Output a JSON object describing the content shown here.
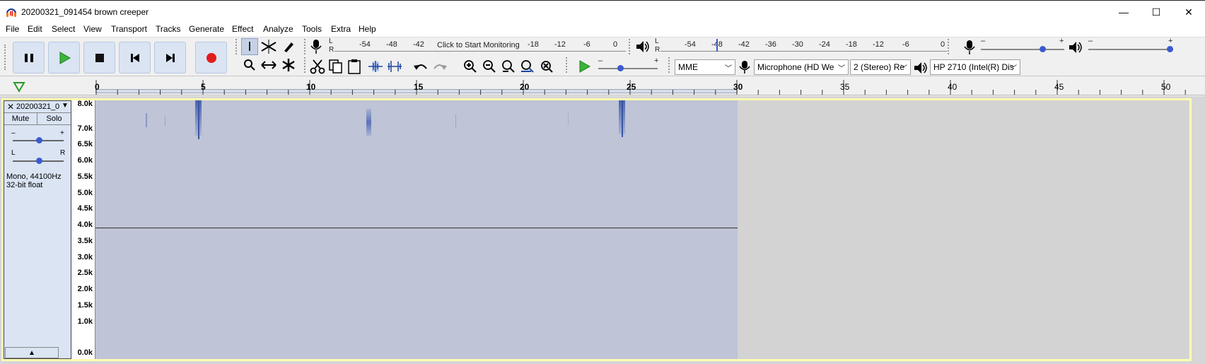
{
  "window": {
    "title": "20200321_091454 brown creeper",
    "minimize": "—",
    "maximize": "☐",
    "close": "✕"
  },
  "menu": [
    "File",
    "Edit",
    "Select",
    "View",
    "Transport",
    "Tracks",
    "Generate",
    "Effect",
    "Analyze",
    "Tools",
    "Extra",
    "Help"
  ],
  "transport": {
    "buttons": [
      "pause",
      "play",
      "stop",
      "skip-start",
      "skip-end",
      "record"
    ]
  },
  "recording_meter": {
    "ticks": [
      "-54",
      "-48",
      "-42",
      "-18",
      "-12",
      "-6",
      "0"
    ],
    "prompt": "Click to Start Monitoring",
    "L": "L",
    "R": "R"
  },
  "playback_meter": {
    "ticks": [
      "-54",
      "-48",
      "-42",
      "-36",
      "-30",
      "-24",
      "-18",
      "-12",
      "-6",
      "0"
    ],
    "L": "L",
    "R": "R"
  },
  "mixer": {
    "minus": "–",
    "plus": "+"
  },
  "devices": {
    "host": "MME",
    "input": "Microphone (HD We",
    "channels": "2 (Stereo) Re",
    "output": "HP 2710 (Intel(R) Dis"
  },
  "timeline": {
    "ticks": [
      "0",
      "5",
      "10",
      "15",
      "20",
      "25",
      "30",
      "35",
      "40",
      "45",
      "50"
    ]
  },
  "track": {
    "name": "20200321_0",
    "mute": "Mute",
    "solo": "Solo",
    "gain_minus": "–",
    "gain_plus": "+",
    "pan_left": "L",
    "pan_right": "R",
    "info_line1": "Mono, 44100Hz",
    "info_line2": "32-bit float",
    "freq_labels": [
      "8.0k",
      "7.0k",
      "6.5k",
      "6.0k",
      "5.5k",
      "5.0k",
      "4.5k",
      "4.0k",
      "3.5k",
      "3.0k",
      "2.5k",
      "2.0k",
      "1.5k",
      "1.0k",
      "0.0k"
    ]
  }
}
